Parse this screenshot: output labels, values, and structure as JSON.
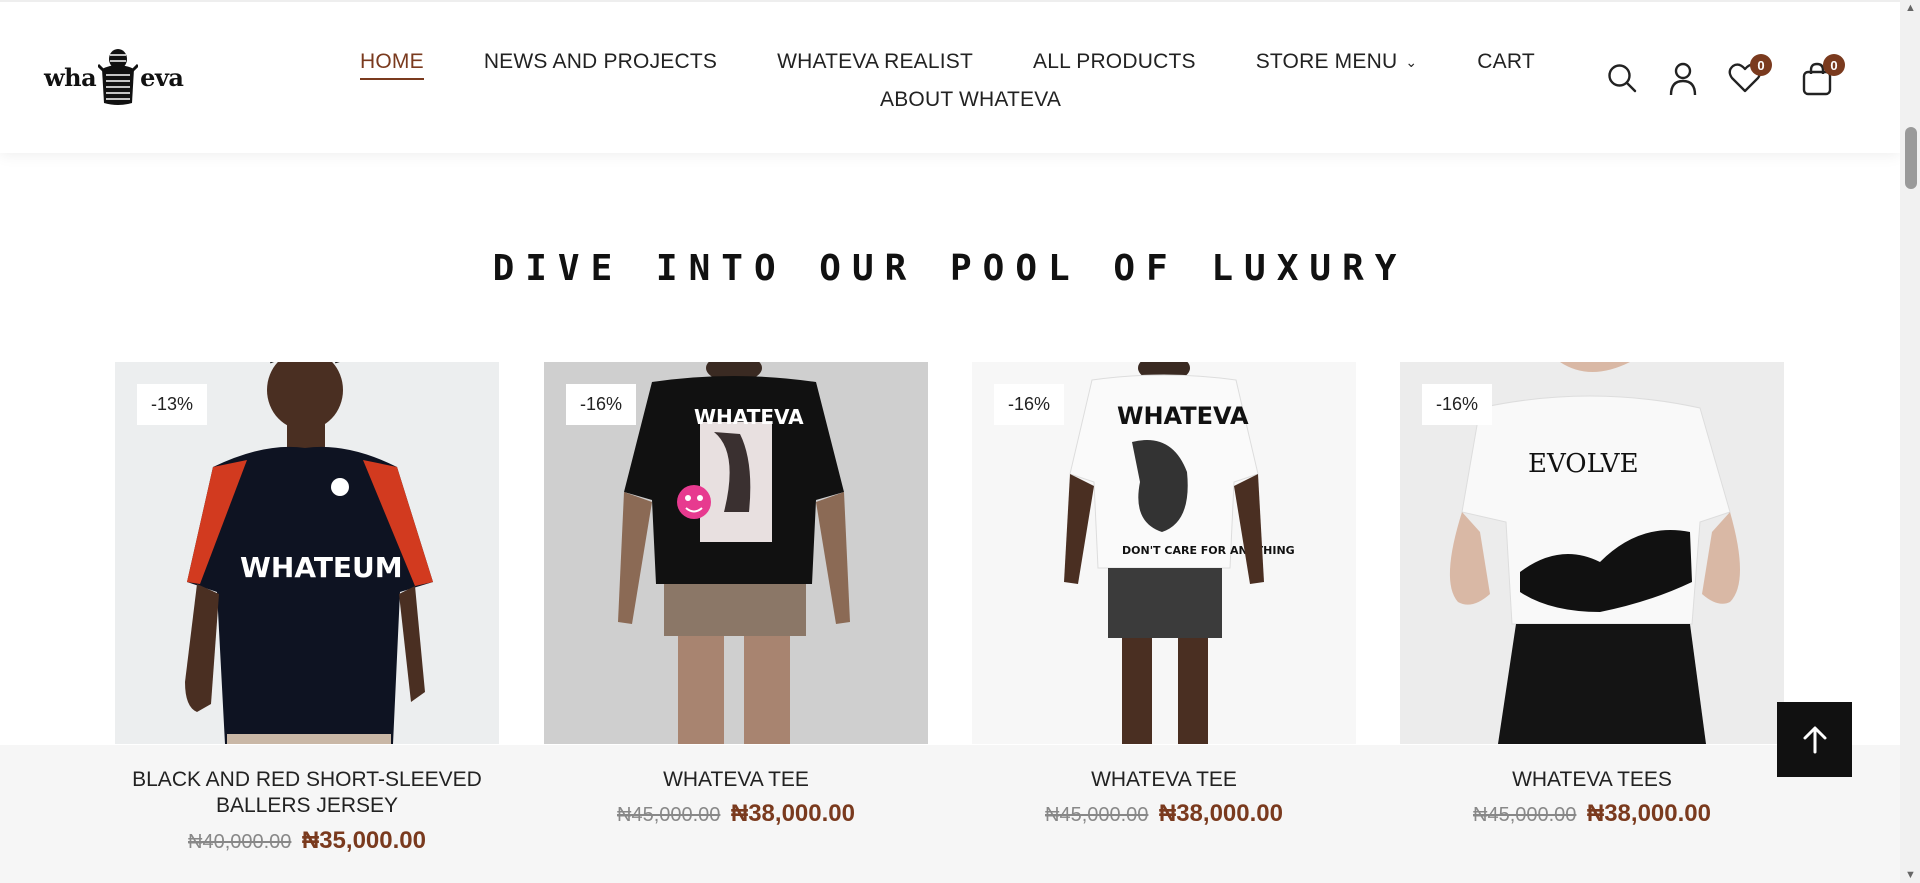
{
  "header": {
    "logo": {
      "left_text": "wha",
      "right_text": "eva"
    },
    "nav": [
      {
        "label": "HOME"
      },
      {
        "label": "NEWS AND PROJECTS"
      },
      {
        "label": "WHATEVA REALIST"
      },
      {
        "label": "ALL PRODUCTS"
      },
      {
        "label": "STORE MENU"
      },
      {
        "label": "CART"
      },
      {
        "label": "ABOUT WHATEVA"
      }
    ],
    "wishlist_count": "0",
    "cart_count": "0"
  },
  "section": {
    "title": "DIVE INTO OUR POOL OF LUXURY"
  },
  "products": [
    {
      "badge": "-13%",
      "title": "BLACK AND RED SHORT-SLEEVED BALLERS JERSEY",
      "old_price": "₦40,000.00",
      "new_price": "₦35,000.00"
    },
    {
      "badge": "-16%",
      "title": "WHATEVA TEE",
      "old_price": "₦45,000.00",
      "new_price": "₦38,000.00"
    },
    {
      "badge": "-16%",
      "title": "WHATEVA TEE",
      "old_price": "₦45,000.00",
      "new_price": "₦38,000.00"
    },
    {
      "badge": "-16%",
      "title": "WHATEVA TEES",
      "old_price": "₦45,000.00",
      "new_price": "₦38,000.00"
    }
  ],
  "colors": {
    "accent": "#7a3a1e",
    "band": "#f6f6f6",
    "back_to_top": "#111111"
  },
  "icons": [
    "search-icon",
    "user-icon",
    "heart-icon",
    "bag-icon",
    "arrow-up-icon",
    "chevron-down-icon"
  ]
}
